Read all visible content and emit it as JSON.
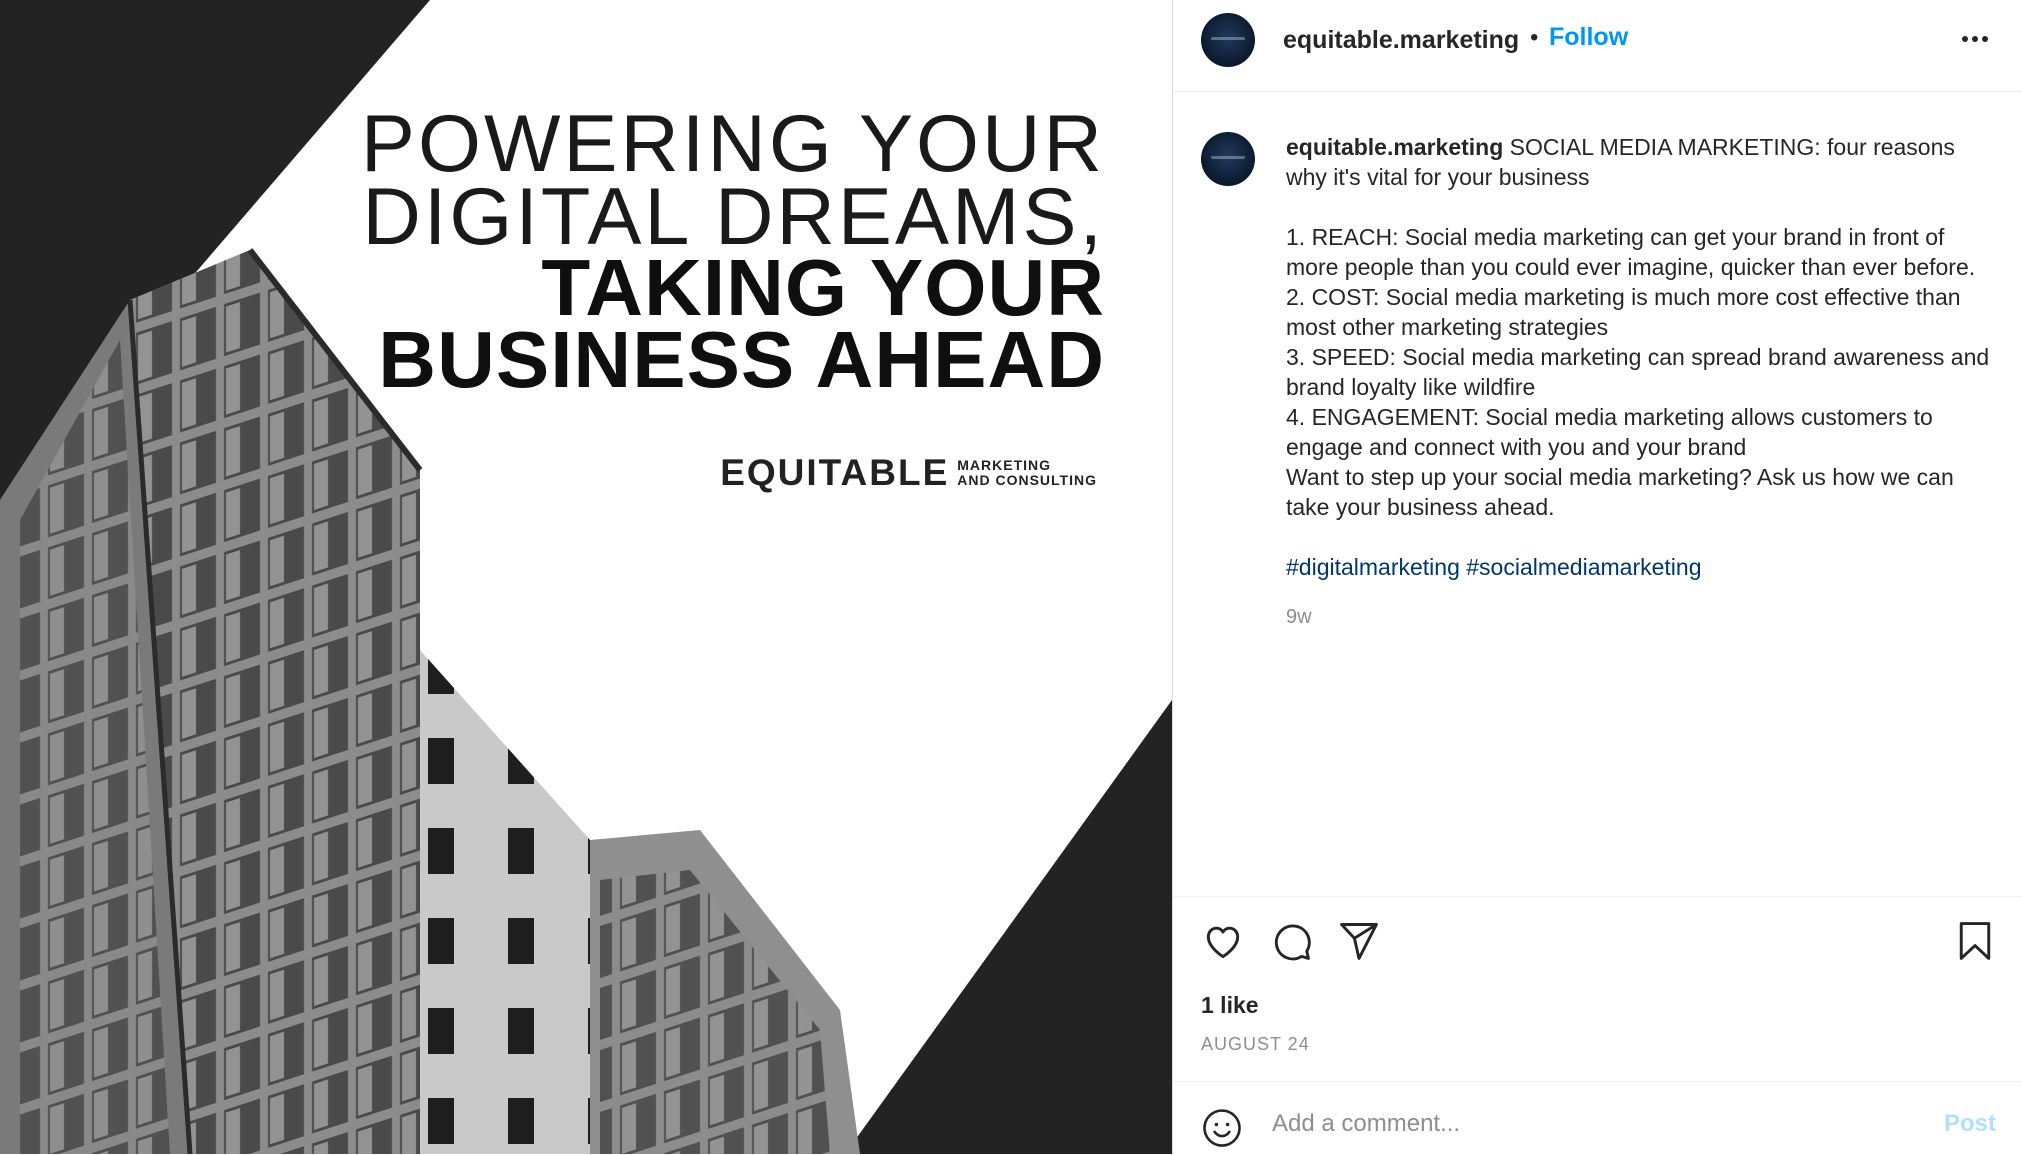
{
  "post_image": {
    "headline_thin": [
      "POWERING YOUR",
      "DIGITAL DREAMS,"
    ],
    "headline_bold": [
      "TAKING YOUR",
      "BUSINESS AHEAD"
    ],
    "brand_name": "EQUITABLE",
    "brand_sub": [
      "MARKETING",
      "AND CONSULTING"
    ]
  },
  "header": {
    "username": "equitable.marketing",
    "separator": "•",
    "follow_label": "Follow",
    "more_icon": "more-horizontal-icon"
  },
  "caption": {
    "username": "equitable.marketing",
    "intro": "SOCIAL MEDIA MARKETING: four reasons why it's vital for your business",
    "points": [
      "1. REACH: Social media marketing can get your brand in front of more people than you could ever imagine, quicker than ever before.",
      "2. COST: Social media marketing is much more cost effective than most other marketing strategies",
      "3. SPEED: Social media marketing can spread brand awareness and brand loyalty like wildfire",
      "4. ENGAGEMENT: Social media marketing allows customers to engage and connect with you and your brand",
      "Want to step up your social media marketing? Ask us how we can take your business ahead."
    ],
    "hashtags": [
      "#digitalmarketing",
      "#socialmediamarketing"
    ],
    "time_ago": "9w"
  },
  "actions": {
    "icons": [
      "heart-icon",
      "comment-icon",
      "share-icon",
      "bookmark-icon"
    ],
    "likes": "1 like",
    "date": "AUGUST 24"
  },
  "comment": {
    "placeholder": "Add a comment...",
    "post_label": "Post",
    "emoji_icon": "emoji-icon"
  },
  "colors": {
    "follow": "#0095f6",
    "hashtag": "#00376b",
    "post_disabled": "#b2dffc",
    "image_dark": "#232323"
  }
}
